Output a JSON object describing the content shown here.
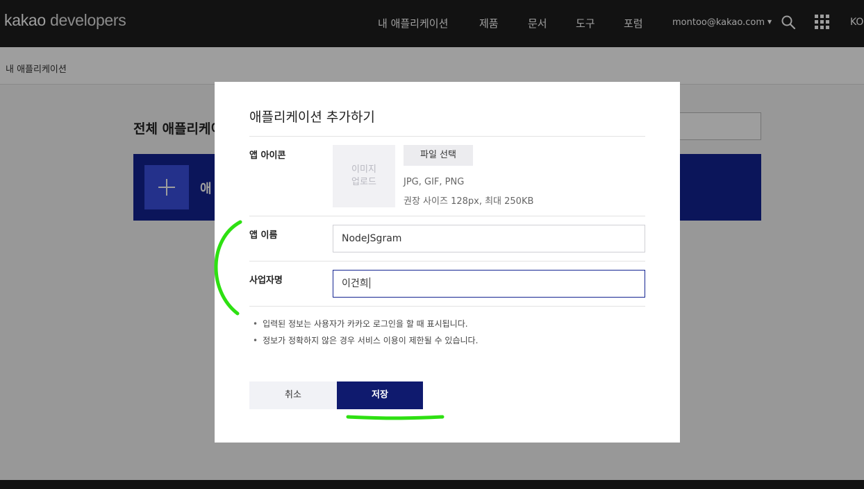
{
  "header": {
    "logo_bold": "kakao",
    "logo_light": "developers",
    "nav": [
      "내 애플리케이션",
      "제품",
      "문서",
      "도구",
      "포럼"
    ],
    "account": "montoo@kakao.com",
    "lang": "KO"
  },
  "breadcrumb": "내 애플리케이션",
  "page": {
    "title": "전체 애플리케이",
    "add_banner_text": "애"
  },
  "modal": {
    "title": "애플리케이션 추가하기",
    "icon_label": "앱 아이콘",
    "icon_upload_line1": "이미지",
    "icon_upload_line2": "업로드",
    "file_button": "파일 선택",
    "file_formats": "JPG, GIF, PNG",
    "file_size_hint": "권장 사이즈 128px, 최대 250KB",
    "app_name_label": "앱 이름",
    "app_name_value": "NodeJSgram",
    "company_label": "사업자명",
    "company_value": "이건희",
    "notices": [
      "입력된 정보는 사용자가 카카오 로그인을 할 때 표시됩니다.",
      "정보가 정확하지 않은 경우 서비스 이용이 제한될 수 있습니다."
    ],
    "cancel_button": "취소",
    "save_button": "저장"
  },
  "colors": {
    "header_bg": "#1d1d1d",
    "accent_navy": "#0f1a6e",
    "banner_blue": "#122391",
    "annotation_green": "#2ee012"
  }
}
